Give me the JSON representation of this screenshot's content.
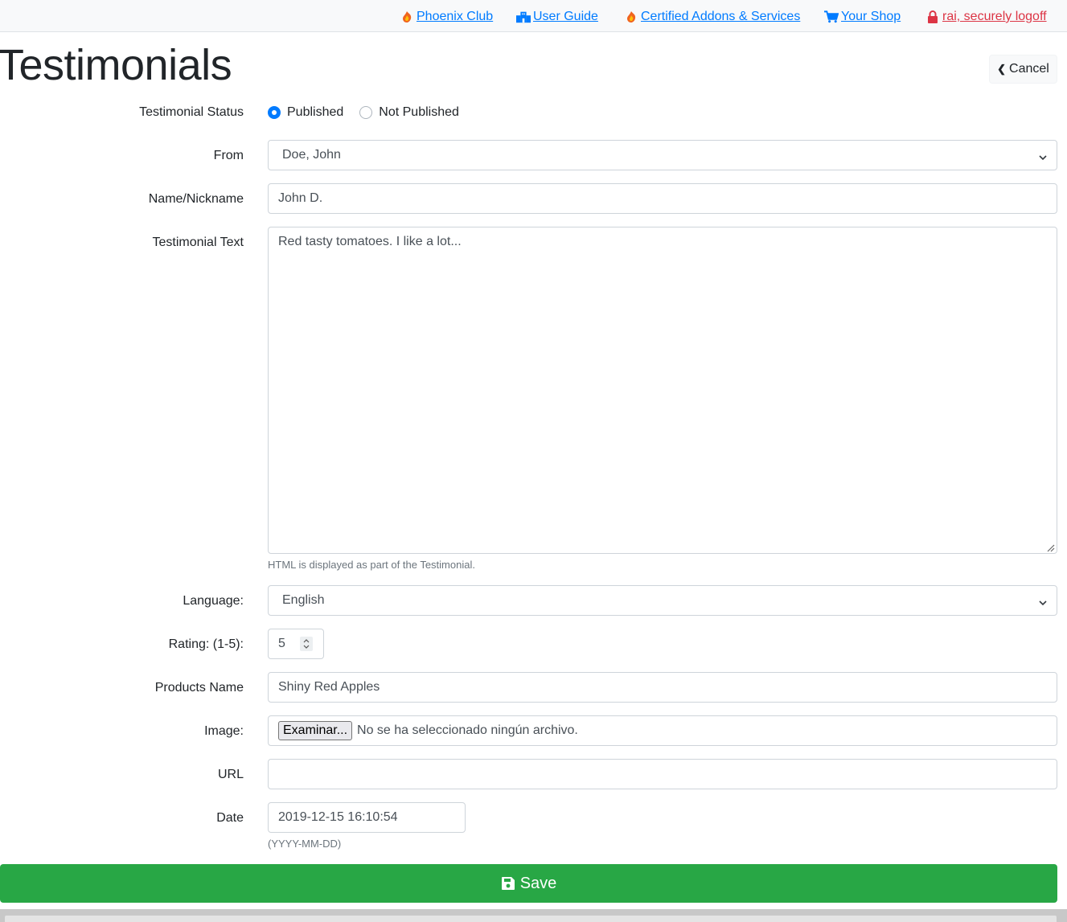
{
  "nav": {
    "links": [
      {
        "label": "Phoenix Club",
        "icon": "phoenix-icon"
      },
      {
        "label": "User Guide",
        "icon": "building-icon"
      },
      {
        "label": "Certified Addons & Services",
        "icon": "phoenix-icon"
      },
      {
        "label": "Your Shop",
        "icon": "cart-icon"
      },
      {
        "label": "rai, securely logoff",
        "icon": "lock-icon"
      }
    ],
    "colors": {
      "link": "#007bff",
      "logoff": "#dc3545"
    }
  },
  "page": {
    "title": "Testimonials",
    "cancel_label": "Cancel"
  },
  "form": {
    "status": {
      "label": "Testimonial Status",
      "options": [
        "Published",
        "Not Published"
      ],
      "selected": "Published"
    },
    "from": {
      "label": "From",
      "value": "Doe, John"
    },
    "nickname": {
      "label": "Name/Nickname",
      "value": "John D."
    },
    "text": {
      "label": "Testimonial Text",
      "value": "Red tasty tomatoes. I like a lot...",
      "help": "HTML is displayed as part of the Testimonial."
    },
    "language": {
      "label": "Language:",
      "value": "English"
    },
    "rating": {
      "label": "Rating: (1-5):",
      "value": "5"
    },
    "product": {
      "label": "Products Name",
      "value": "Shiny Red Apples"
    },
    "image": {
      "label": "Image:",
      "button": "Examinar...",
      "status": "No se ha seleccionado ningún archivo."
    },
    "url": {
      "label": "URL",
      "value": ""
    },
    "date": {
      "label": "Date",
      "value": "2019-12-15 16:10:54",
      "help": "(YYYY-MM-DD)"
    }
  },
  "save": {
    "label": "Save",
    "color": "#28a745"
  }
}
